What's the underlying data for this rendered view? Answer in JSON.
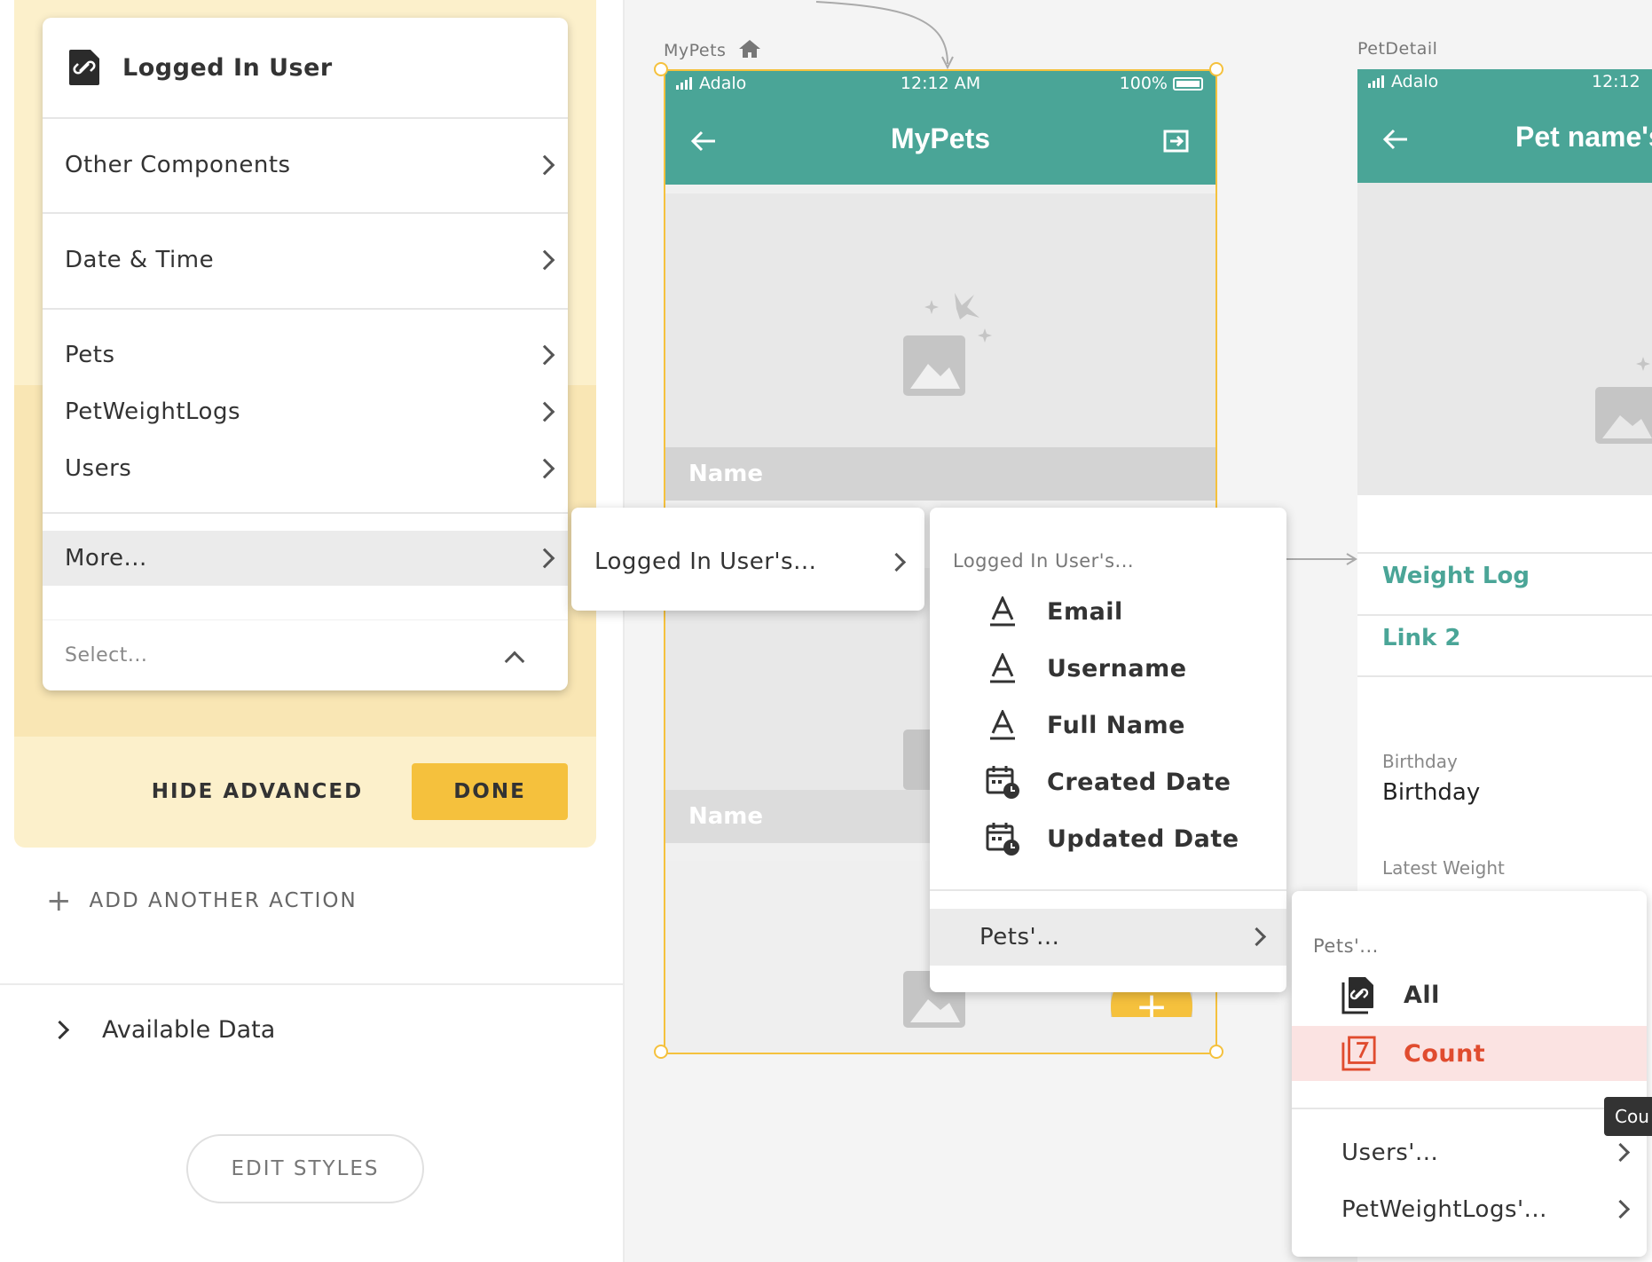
{
  "left_panel": {
    "dropdown": {
      "header": "Logged In User",
      "items": [
        {
          "label": "Other Components"
        },
        {
          "label": "Date & Time"
        },
        {
          "label": "Pets"
        },
        {
          "label": "PetWeightLogs"
        },
        {
          "label": "Users"
        },
        {
          "label": "More..."
        }
      ],
      "select_placeholder": "Select..."
    },
    "hide_advanced_label": "HIDE ADVANCED",
    "done_label": "DONE",
    "add_action_label": "ADD ANOTHER ACTION",
    "available_data_label": "Available Data",
    "edit_styles_label": "EDIT STYLES"
  },
  "canvas": {
    "screen1": {
      "label": "MyPets",
      "status": {
        "carrier": "Adalo",
        "time": "12:12 AM",
        "battery": "100%"
      },
      "title": "MyPets",
      "name_label_1": "Name",
      "name_label_2": "Name"
    },
    "screen2": {
      "label": "PetDetail",
      "status": {
        "carrier": "Adalo",
        "time": "12:12"
      },
      "title": "Pet name's",
      "links": [
        "Weight Log",
        "Link 2"
      ],
      "birthday_label": "Birthday",
      "birthday_value": "Birthday",
      "latest_weight_label": "Latest Weight"
    }
  },
  "submenu_logged_in": {
    "label": "Logged In User's..."
  },
  "properties_menu": {
    "header": "Logged In User's...",
    "items": [
      {
        "label": "Email",
        "icon": "text-icon"
      },
      {
        "label": "Username",
        "icon": "text-icon"
      },
      {
        "label": "Full Name",
        "icon": "text-icon"
      },
      {
        "label": "Created Date",
        "icon": "calendar-clock-icon"
      },
      {
        "label": "Updated Date",
        "icon": "calendar-clock-icon"
      }
    ],
    "pets_label": "Pets'..."
  },
  "pets_menu": {
    "header": "Pets'...",
    "all_label": "All",
    "count_label": "Count",
    "users_label": "Users'...",
    "weightlogs_label": "PetWeightLogs'..."
  },
  "tooltip": {
    "text": "Cou"
  },
  "colors": {
    "accent": "#f5c13d",
    "teal": "#4aa597",
    "count_red": "#e04c2f",
    "count_bg": "#fbe3e2"
  }
}
